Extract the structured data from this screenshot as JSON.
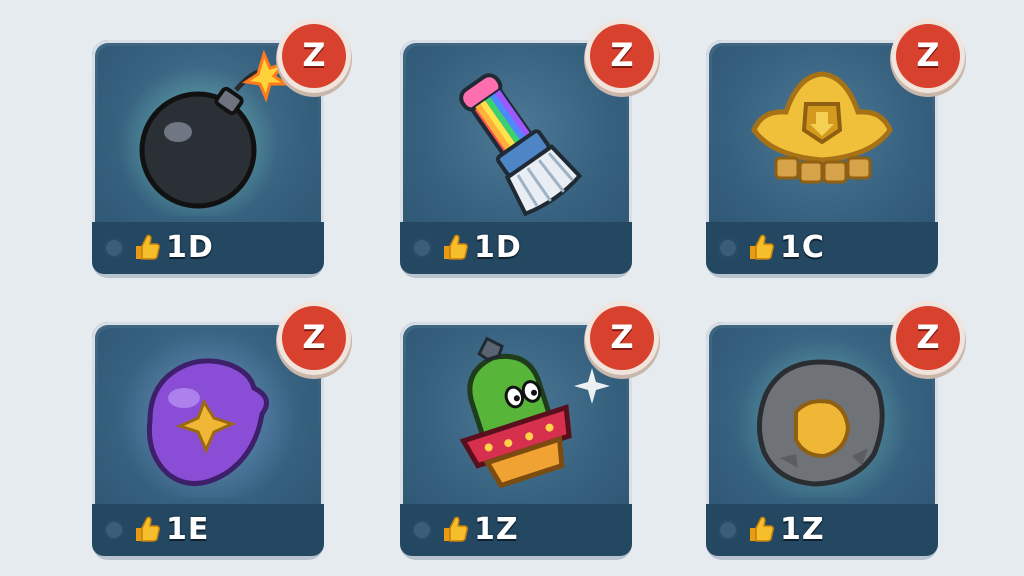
{
  "items": [
    {
      "name": "bomb-item",
      "badge": "Z",
      "value": "1D"
    },
    {
      "name": "rainbow-brush-item",
      "badge": "Z",
      "value": "1D"
    },
    {
      "name": "golden-crown-item",
      "badge": "Z",
      "value": "1C"
    },
    {
      "name": "purple-gem-item",
      "badge": "Z",
      "value": "1E"
    },
    {
      "name": "cactus-pot-item",
      "badge": "Z",
      "value": "1Z"
    },
    {
      "name": "stone-shield-item",
      "badge": "Z",
      "value": "1Z"
    }
  ],
  "icons": {
    "currency": "thumbs-up-icon",
    "badge": "z-badge-icon",
    "status": "status-dot-icon"
  },
  "colors": {
    "card_bg": "#35607e",
    "badge_red": "#d8412d",
    "thumb_gold": "#f2b51e",
    "footer": "#244862"
  }
}
